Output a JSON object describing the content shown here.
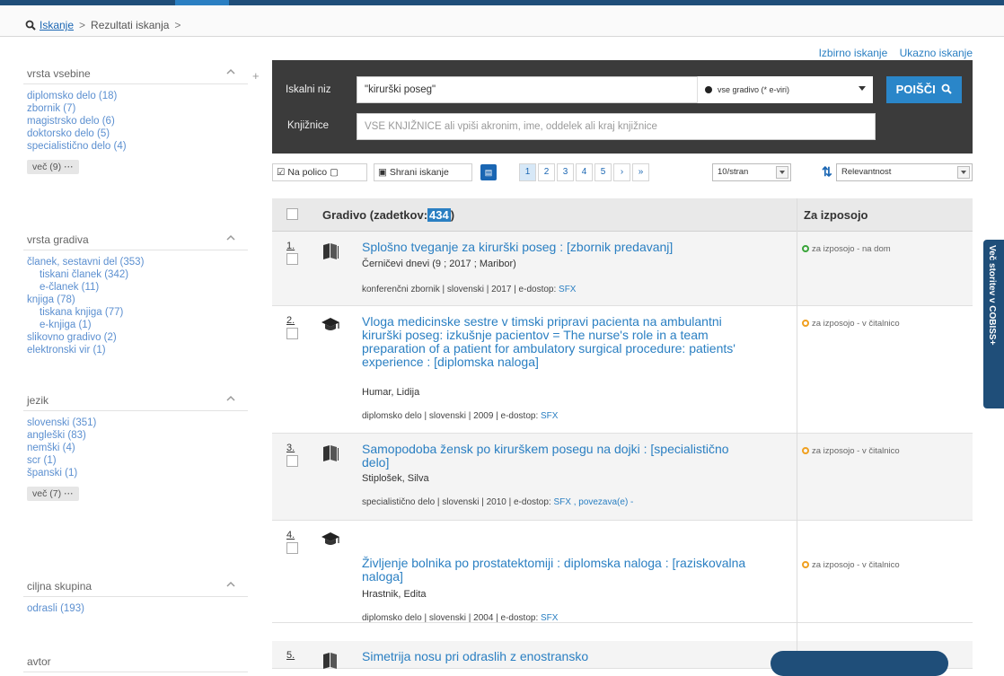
{
  "breadcrumb": {
    "search_link": "Iskanje",
    "sep1": ">",
    "results": "Rezultati iskanja",
    "sep2": ">"
  },
  "top_links": {
    "basic": "Izbirno iskanje",
    "advanced": "Ukazno iskanje"
  },
  "facets": [
    {
      "title": "vrsta vsebine",
      "items": [
        {
          "label": "diplomsko delo (18)",
          "sub": false
        },
        {
          "label": "zbornik (7)",
          "sub": false
        },
        {
          "label": "magistrsko delo (6)",
          "sub": false
        },
        {
          "label": "doktorsko delo (5)",
          "sub": false
        },
        {
          "label": "specialistično delo (4)",
          "sub": false
        }
      ],
      "more": "več (9) ⋯"
    },
    {
      "title": "vrsta gradiva",
      "items": [
        {
          "label": "članek, sestavni del (353)",
          "sub": false
        },
        {
          "label": "tiskani članek (342)",
          "sub": true
        },
        {
          "label": "e-članek (11)",
          "sub": true
        },
        {
          "label": "knjiga (78)",
          "sub": false
        },
        {
          "label": "tiskana knjiga (77)",
          "sub": true
        },
        {
          "label": "e-knjiga (1)",
          "sub": true
        },
        {
          "label": "slikovno gradivo (2)",
          "sub": false
        },
        {
          "label": "elektronski vir (1)",
          "sub": false
        }
      ],
      "more": ""
    },
    {
      "title": "jezik",
      "items": [
        {
          "label": "slovenski (351)",
          "sub": false
        },
        {
          "label": "angleški (83)",
          "sub": false
        },
        {
          "label": "nemški (4)",
          "sub": false
        },
        {
          "label": "scr (1)",
          "sub": false
        },
        {
          "label": "španski (1)",
          "sub": false
        }
      ],
      "more": "več (7) ⋯"
    },
    {
      "title": "ciljna skupina",
      "items": [
        {
          "label": "odrasli (193)",
          "sub": false
        }
      ],
      "more": ""
    },
    {
      "title": "avtor",
      "items": [],
      "more": ""
    }
  ],
  "search": {
    "query_label": "Iskalni niz",
    "query_value": "\"kirurški poseg\"",
    "scope_value": "vse gradivo (* e-viri)",
    "submit_label": "POIŠČI",
    "libraries_label": "Knjižnice",
    "libraries_placeholder": "VSE KNJIŽNICE ali vpiši akronim, ime, oddelek ali kraj knjižnice"
  },
  "toolbar": {
    "shelf_label": "Na polico",
    "save_label": "Shrani iskanje",
    "pages": [
      "1",
      "2",
      "3",
      "4",
      "5",
      "›",
      "»"
    ],
    "per_page": "10/stran",
    "sort": "Relevantnost"
  },
  "table": {
    "col_title": "Gradivo  (zadetkov:",
    "hits": "434",
    "col_title_end": ")",
    "col_avail": "Za izposojo"
  },
  "results": [
    {
      "num": "1.",
      "icon": "book-icon",
      "title": "Splošno tveganje za kirurški poseg : [zbornik predavanj]",
      "author": "Černičevi dnevi (9 ; 2017 ; Maribor)",
      "meta": "konferenčni zbornik | slovenski | 2017 | e-dostop: ",
      "link": "SFX",
      "avail": "za izposojo - na dom",
      "avail_color": "#3aa53a"
    },
    {
      "num": "2.",
      "icon": "graduation-cap-icon",
      "title": "Vloga medicinske sestre v timski pripravi pacienta na ambulantni kirurški poseg: izkušnje pacientov = The nurse's role in a team preparation of a patient for ambulatory surgical procedure: patients' experience : [diplomska naloga]",
      "author": "Humar, Lidija",
      "meta": "diplomsko delo | slovenski | 2009 | e-dostop: ",
      "link": "SFX",
      "avail": "za izposojo - v čitalnico",
      "avail_color": "#f0a020"
    },
    {
      "num": "3.",
      "icon": "book-icon",
      "title": "Samopodoba žensk po kirurškem posegu na dojki : [specialistično delo]",
      "author": "Stiplošek, Silva",
      "meta": "specialistično delo | slovenski | 2010 | e-dostop: ",
      "link": "SFX ,  povezava(e) -",
      "avail": "za izposojo - v čitalnico",
      "avail_color": "#f0a020"
    },
    {
      "num": "4.",
      "icon": "graduation-cap-icon",
      "title": "Življenje bolnika po prostatektomiji : diplomska naloga : [raziskovalna naloga]",
      "author": "Hrastnik, Edita",
      "meta": "diplomsko delo | slovenski | 2004 | e-dostop: ",
      "link": "SFX",
      "avail": "za izposojo - v čitalnico",
      "avail_color": "#f0a020"
    },
    {
      "num": "5.",
      "icon": "book-icon",
      "title": "Simetrija nosu pri odraslih z enostransko",
      "author": "",
      "meta": "",
      "link": "",
      "avail": "",
      "avail_color": "#f0a020"
    }
  ],
  "side_tab": "Več storitev v COBISS+"
}
